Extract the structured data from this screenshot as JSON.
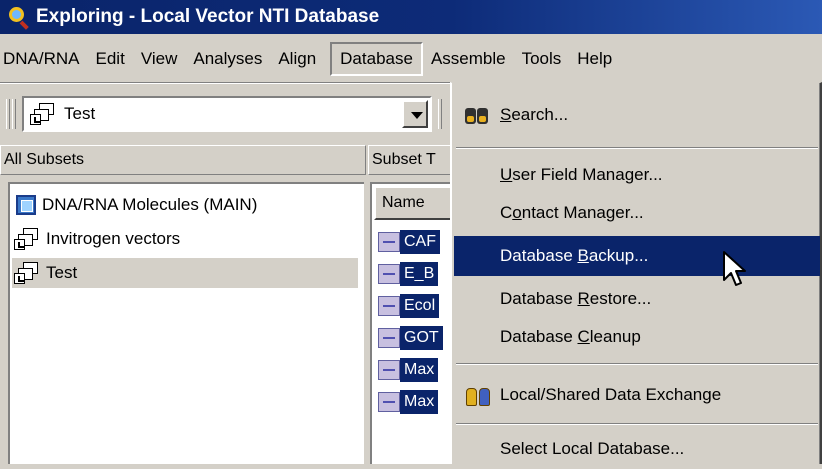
{
  "window": {
    "title": "Exploring - Local Vector NTI Database"
  },
  "menubar": {
    "items": [
      "DNA/RNA",
      "Edit",
      "View",
      "Analyses",
      "Align",
      "Database",
      "Assemble",
      "Tools",
      "Help"
    ],
    "open": "Database"
  },
  "toolbar": {
    "subset_value": "Test"
  },
  "left_pane": {
    "header": "All Subsets",
    "items": [
      {
        "label": "DNA/RNA Molecules (MAIN)",
        "icon": "database-icon"
      },
      {
        "label": "Invitrogen vectors",
        "icon": "subset-icon"
      },
      {
        "label": "Test",
        "icon": "subset-icon",
        "selected": true
      }
    ]
  },
  "right_pane": {
    "header": "Subset T",
    "column_name": "Name",
    "rows": [
      "CAF",
      "E_B",
      "Ecol",
      "GOT",
      "Max",
      "Max"
    ]
  },
  "database_menu": {
    "items": [
      {
        "pre": "",
        "key": "S",
        "post": "earch...",
        "icon": "binoculars-icon"
      },
      {
        "pre": "",
        "key": "U",
        "post": "ser Field Manager..."
      },
      {
        "pre": "C",
        "key": "o",
        "post": "ntact Manager..."
      },
      {
        "pre": "Database ",
        "key": "B",
        "post": "ackup...",
        "highlighted": true
      },
      {
        "pre": "Database ",
        "key": "R",
        "post": "estore..."
      },
      {
        "pre": "Database ",
        "key": "C",
        "post": "leanup"
      },
      {
        "pre": "",
        "key": "",
        "post": "Local/Shared Data Exchange",
        "icon": "data-exchange-icon"
      },
      {
        "pre": "",
        "key": "",
        "post": "Select Local Database..."
      }
    ]
  },
  "colors": {
    "highlight": "#0a246a",
    "face": "#d4d0c8"
  }
}
